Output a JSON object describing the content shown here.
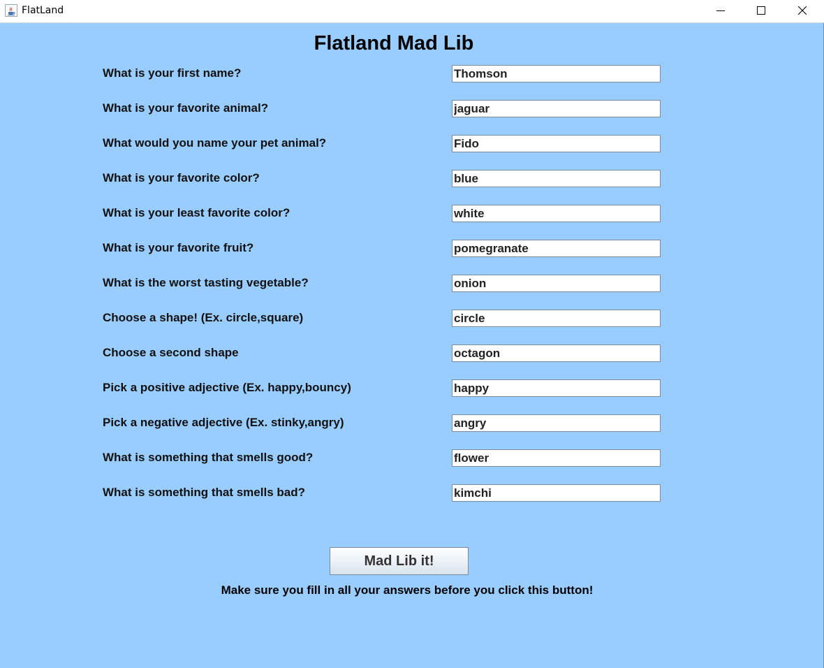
{
  "window": {
    "title": "FlatLand",
    "app_icon": "java-cup-icon",
    "minimize_icon": "minimize-icon",
    "maximize_icon": "maximize-icon",
    "close_icon": "close-icon",
    "background_color": "#99ccff"
  },
  "form": {
    "heading": "Flatland Mad Lib",
    "questions": [
      {
        "label": "What is your first name?",
        "value": "Thomson"
      },
      {
        "label": "What is your favorite animal?",
        "value": "jaguar"
      },
      {
        "label": "What would you name your pet animal?",
        "value": "Fido"
      },
      {
        "label": "What is your favorite color?",
        "value": "blue"
      },
      {
        "label": "What is your least favorite color?",
        "value": "white"
      },
      {
        "label": "What is your favorite fruit?",
        "value": "pomegranate"
      },
      {
        "label": "What is the worst tasting vegetable?",
        "value": "onion"
      },
      {
        "label": "Choose a shape! (Ex. circle,square)",
        "value": "circle"
      },
      {
        "label": "Choose a second shape",
        "value": "octagon"
      },
      {
        "label": "Pick a positive adjective (Ex. happy,bouncy)",
        "value": "happy"
      },
      {
        "label": "Pick a negative adjective (Ex. stinky,angry)",
        "value": "angry"
      },
      {
        "label": "What is something that smells good?",
        "value": "flower"
      },
      {
        "label": "What is something that smells bad?",
        "value": "kimchi"
      }
    ],
    "submit_label": "Mad Lib it!",
    "hint": "Make sure you fill in all your answers before you click this button!"
  }
}
